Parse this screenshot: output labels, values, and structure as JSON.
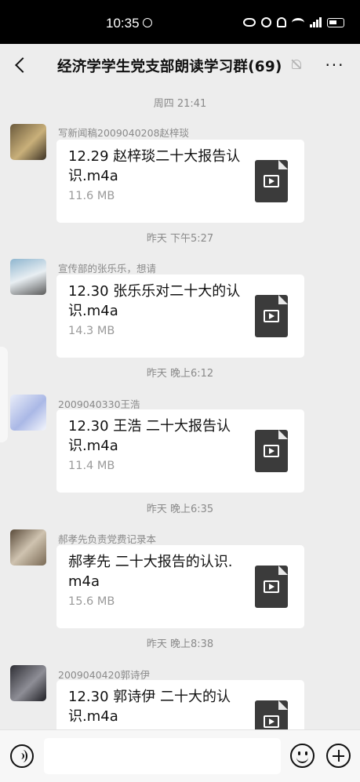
{
  "status_bar": {
    "time": "10:35",
    "network": "4G"
  },
  "header": {
    "title": "经济学学生党支部朗读学习群(69)"
  },
  "messages": [
    {
      "time": "周四 21:41",
      "sender": "写新闻稿2009040208赵梓琰",
      "file_name": "12.29 赵梓琰二十大报告认识.m4a",
      "file_size": "11.6 MB"
    },
    {
      "time": "昨天 下午5:27",
      "sender": "宣传部的张乐乐，想请",
      "file_name": "12.30 张乐乐对二十大的认识.m4a",
      "file_size": "14.3 MB"
    },
    {
      "time": "昨天 晚上6:12",
      "sender": "2009040330王浩",
      "file_name": "12.30 王浩 二十大报告认识.m4a",
      "file_size": "11.4 MB"
    },
    {
      "time": "昨天 晚上6:35",
      "sender": "郝孝先负责党费记录本",
      "file_name": "郝孝先 二十大报告的认识.m4a",
      "file_size": "15.6 MB"
    },
    {
      "time": "昨天 晚上8:38",
      "sender": "2009040420郭诗伊",
      "file_name": "12.30 郭诗伊 二十大的认识.m4a",
      "file_size": ""
    }
  ],
  "input": {
    "placeholder": ""
  },
  "colors": {
    "background": "#ededed",
    "bubble": "#ffffff",
    "file_icon": "#3b3b3b"
  }
}
